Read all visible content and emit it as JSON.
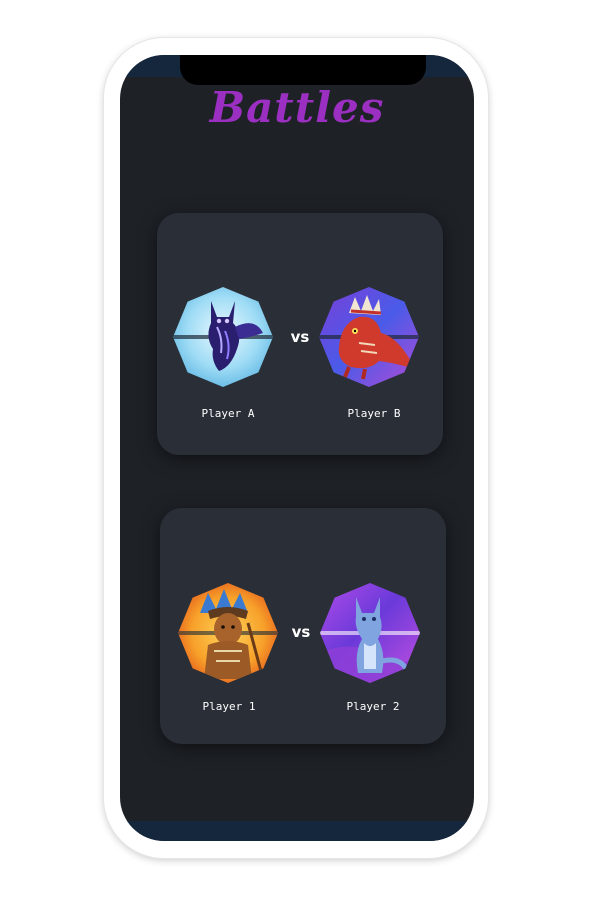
{
  "page": {
    "title": "Battles",
    "title_color": "#9b2fc1"
  },
  "battles": [
    {
      "vs_label": "vs",
      "player_left": {
        "name": "Player A",
        "icon": "shadow-cat-creature-icon"
      },
      "player_right": {
        "name": "Player B",
        "icon": "red-dragon-headdress-icon"
      }
    },
    {
      "vs_label": "vs",
      "player_left": {
        "name": "Player 1",
        "icon": "tribal-warrior-icon"
      },
      "player_right": {
        "name": "Player 2",
        "icon": "blue-wolf-icon"
      }
    }
  ]
}
